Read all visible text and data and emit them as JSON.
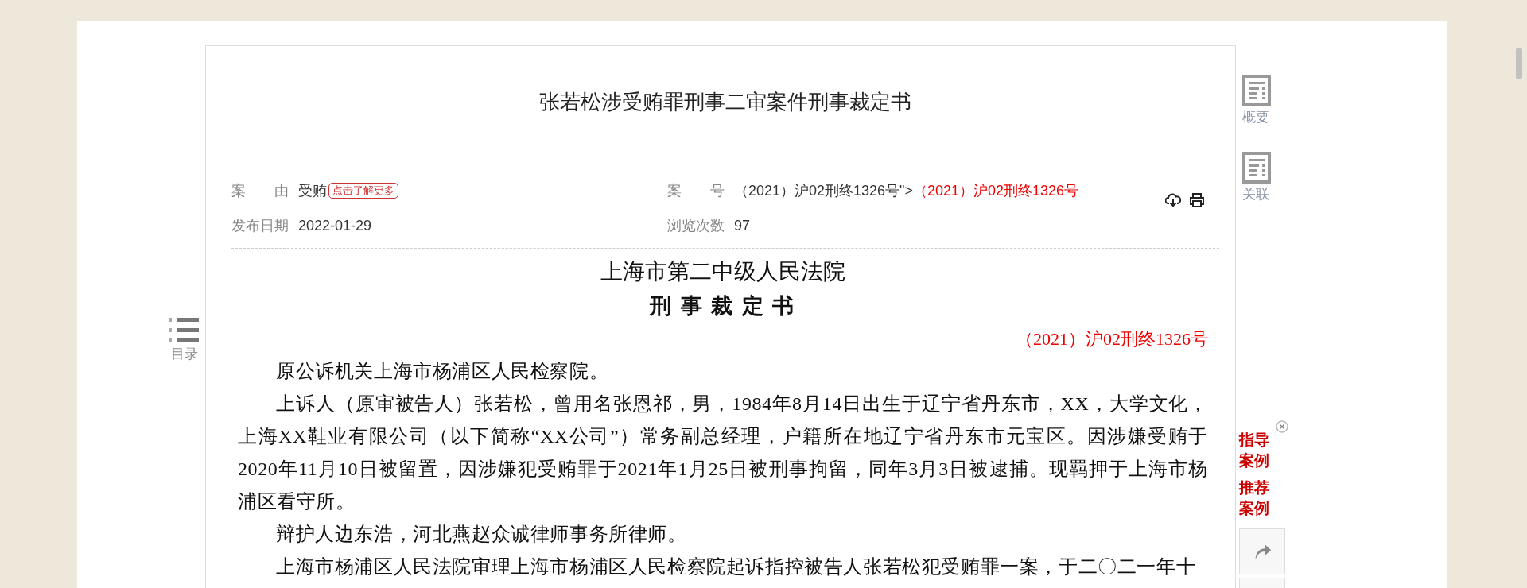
{
  "title": "张若松涉受贿罪刑事二审案件刑事裁定书",
  "meta": {
    "cause": {
      "label": "案　　由",
      "value": "受贿",
      "badge": "点击了解更多"
    },
    "case_number": {
      "label": "案　　号",
      "value": "（2021）沪02刑终1326号\">",
      "highlight": "（2021）沪02刑终1326号"
    },
    "publish_date": {
      "label": "发布日期",
      "value": "2022-01-29"
    },
    "views": {
      "label": "浏览次数",
      "value": "97"
    }
  },
  "document": {
    "court": "上海市第二中级人民法院",
    "doc_type": "刑 事 裁 定 书",
    "doc_number": "（2021）沪02刑终1326号",
    "paragraphs": [
      "原公诉机关上海市杨浦区人民检察院。",
      "上诉人（原审被告人）张若松，曾用名张恩祁，男，1984年8月14日出生于辽宁省丹东市，XX，大学文化，上海XX鞋业有限公司（以下简称“XX公司”）常务副总经理，户籍所在地辽宁省丹东市元宝区。因涉嫌受贿于2020年11月10日被留置，因涉嫌犯受贿罪于2021年1月25日被刑事拘留，同年3月3日被逮捕。现羁押于上海市杨浦区看守所。",
      "辩护人边东浩，河北燕赵众诚律师事务所律师。",
      "上海市杨浦区人民法院审理上海市杨浦区人民检察院起诉指控被告人张若松犯受贿罪一案，于二〇二一年十"
    ]
  },
  "toc": {
    "label": "目录"
  },
  "side_tools": [
    {
      "label": "概要"
    },
    {
      "label": "关联"
    }
  ],
  "promos": [
    "指导案例",
    "推荐案例"
  ]
}
